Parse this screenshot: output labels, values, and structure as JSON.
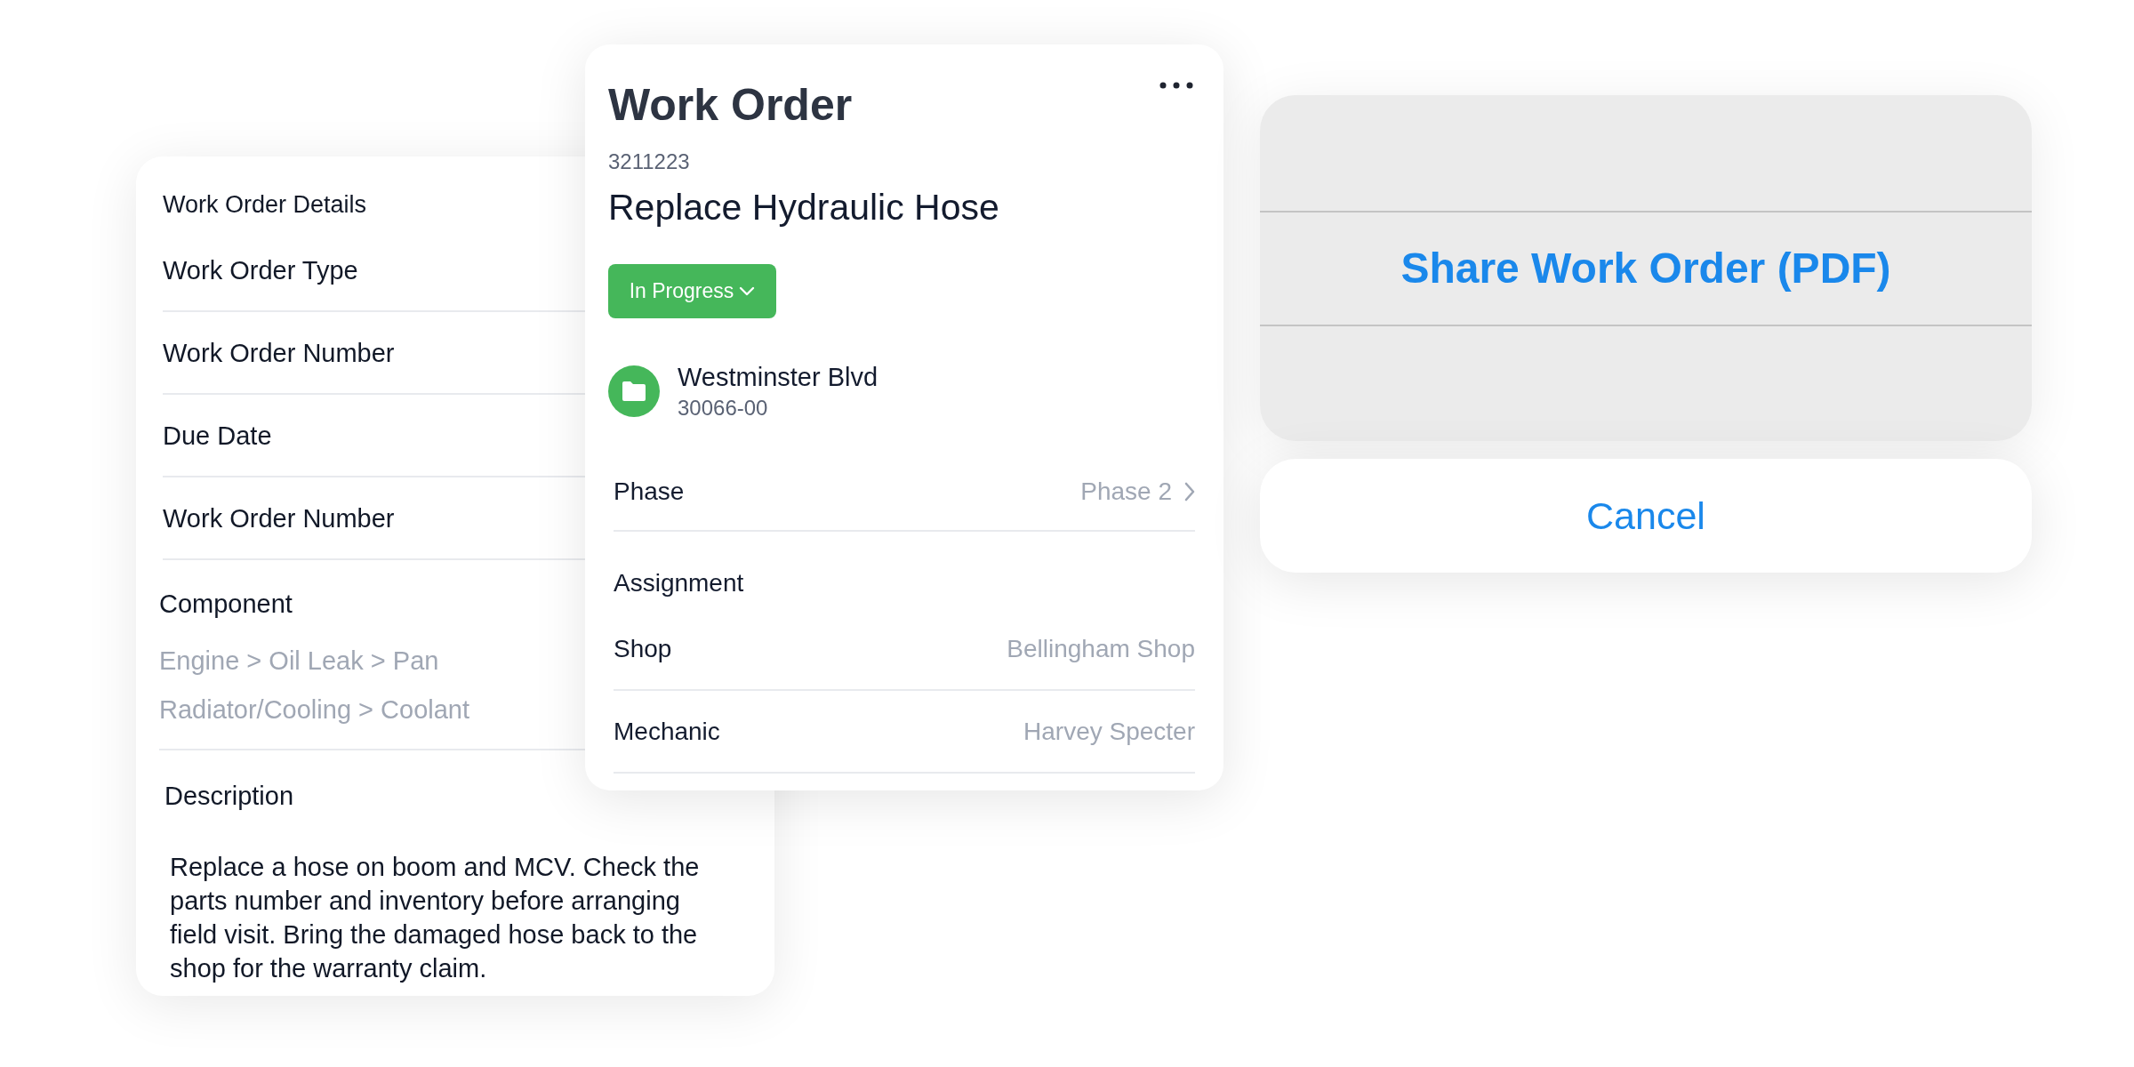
{
  "details_card": {
    "title": "Work Order Details",
    "fields": [
      {
        "label": "Work Order Type"
      },
      {
        "label": "Work Order Number"
      },
      {
        "label": "Due Date"
      },
      {
        "label": "Work Order Number"
      }
    ],
    "component": {
      "label": "Component",
      "values": [
        "Engine > Oil Leak > Pan",
        "Radiator/Cooling > Coolant"
      ]
    },
    "description": {
      "label": "Description",
      "text": "Replace a hose on boom and MCV. Check the parts number and inventory before arranging field visit. Bring the damaged hose back to the shop for the warranty claim."
    }
  },
  "work_order_card": {
    "heading": "Work Order",
    "number": "3211223",
    "title": "Replace Hydraulic Hose",
    "status": {
      "label": "In Progress"
    },
    "site": {
      "name": "Westminster Blvd",
      "code": "30066-00"
    },
    "phase": {
      "label": "Phase",
      "value": "Phase 2"
    },
    "assignment": {
      "heading": "Assignment",
      "rows": [
        {
          "label": "Shop",
          "value": "Bellingham Shop"
        },
        {
          "label": "Mechanic",
          "value": "Harvey Specter"
        }
      ]
    }
  },
  "action_sheet": {
    "actions": [
      {
        "label": "Share Work Order (PDF)"
      }
    ],
    "cancel": {
      "label": "Cancel"
    }
  }
}
